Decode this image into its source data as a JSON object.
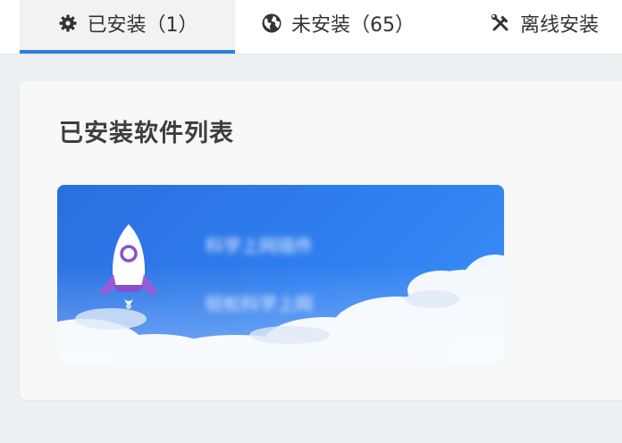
{
  "tabs": [
    {
      "label": "已安装（1）",
      "icon": "gear-icon"
    },
    {
      "label": "未安装（65）",
      "icon": "globe-icon"
    },
    {
      "label": "离线安装",
      "icon": "tools-icon"
    }
  ],
  "section": {
    "title": "已安装软件列表"
  },
  "apps": [
    {
      "name": "科学上网插件",
      "description": "轻松科学上网",
      "icon": "rocket-icon"
    }
  ],
  "colors": {
    "accent": "#2f7fd8",
    "card_blue": "#2f7ff0",
    "background": "#edf0f3"
  }
}
